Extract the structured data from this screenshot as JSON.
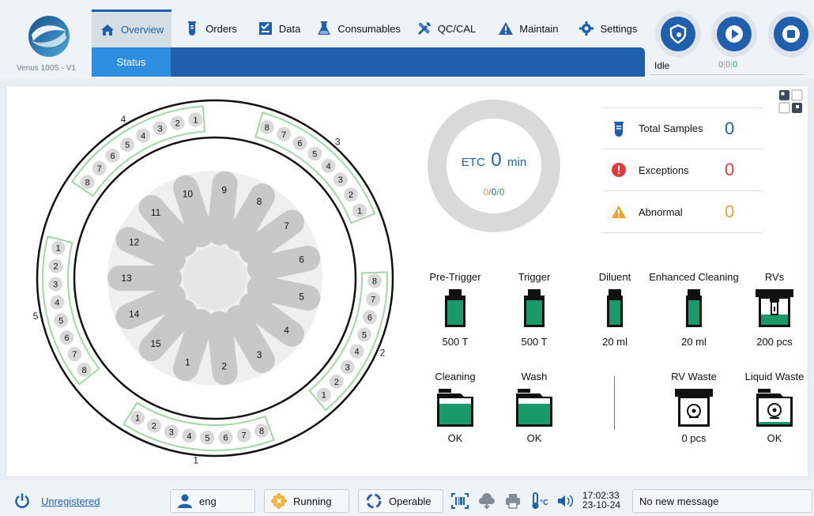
{
  "header": {
    "device_name": "Venus 100S - V1",
    "tabs": [
      {
        "label": "Overview",
        "icon": "home-icon"
      },
      {
        "label": "Orders",
        "icon": "test-tube-icon"
      },
      {
        "label": "Data",
        "icon": "checklist-icon"
      },
      {
        "label": "Consumables",
        "icon": "flask-icon"
      },
      {
        "label": "QC/CAL",
        "icon": "tools-icon"
      },
      {
        "label": "Maintain",
        "icon": "warning-icon"
      },
      {
        "label": "Settings",
        "icon": "gear-icon"
      }
    ],
    "subtab": "Status",
    "status": "Idle",
    "status_counts": [
      "0",
      "0",
      "0"
    ]
  },
  "carousel": {
    "outer_racks": [
      {
        "label": "1",
        "positions": [
          "1",
          "2",
          "3",
          "4",
          "5",
          "6",
          "7",
          "8"
        ]
      },
      {
        "label": "2",
        "positions": [
          "1",
          "2",
          "3",
          "4",
          "5",
          "6",
          "7",
          "8"
        ]
      },
      {
        "label": "3",
        "positions": [
          "1",
          "2",
          "3",
          "4",
          "5",
          "6",
          "7",
          "8"
        ]
      },
      {
        "label": "4",
        "positions": [
          "1",
          "2",
          "3",
          "4",
          "5",
          "6",
          "7",
          "8"
        ]
      },
      {
        "label": "5",
        "positions": [
          "1",
          "2",
          "3",
          "4",
          "5",
          "6",
          "7",
          "8"
        ]
      }
    ],
    "inner_slots": [
      "1",
      "2",
      "3",
      "4",
      "5",
      "6",
      "7",
      "8",
      "9",
      "10",
      "11",
      "12",
      "13",
      "14",
      "15"
    ]
  },
  "etc": {
    "label": "ETC",
    "value": "0",
    "unit": "min",
    "counts": [
      "0",
      "0",
      "0"
    ]
  },
  "stats": [
    {
      "label": "Total Samples",
      "value": "0",
      "color": "#1f5fae",
      "icon": "sample-tube-icon"
    },
    {
      "label": "Exceptions",
      "value": "0",
      "color": "#e0393e",
      "icon": "exclamation-icon"
    },
    {
      "label": "Abnormal",
      "value": "0",
      "color": "#f0a32a",
      "icon": "warning-icon"
    }
  ],
  "consumables": {
    "pre_trigger": {
      "label": "Pre-Trigger",
      "value": "500 T"
    },
    "trigger": {
      "label": "Trigger",
      "value": "500 T"
    },
    "diluent": {
      "label": "Diluent",
      "value": "20 ml"
    },
    "enhanced_cleaning": {
      "label": "Enhanced Cleaning",
      "value": "20 ml"
    },
    "rvs": {
      "label": "RVs",
      "value": "200 pcs"
    },
    "cleaning": {
      "label": "Cleaning",
      "value": "OK"
    },
    "wash": {
      "label": "Wash",
      "value": "OK"
    },
    "rv_waste": {
      "label": "RV Waste",
      "value": "0 pcs"
    },
    "liquid_waste": {
      "label": "Liquid Waste",
      "value": "OK"
    }
  },
  "footer": {
    "registration": "Unregistered",
    "language": "eng",
    "run_status": "Running",
    "operable": "Operable",
    "time": "17:02:33",
    "date": "23-10-24",
    "message": "No new message"
  },
  "colors": {
    "primary": "#1f5fae",
    "accent": "#2e8fe0",
    "liquid": "#1a9a6a",
    "rack": "#a5d6a7"
  }
}
